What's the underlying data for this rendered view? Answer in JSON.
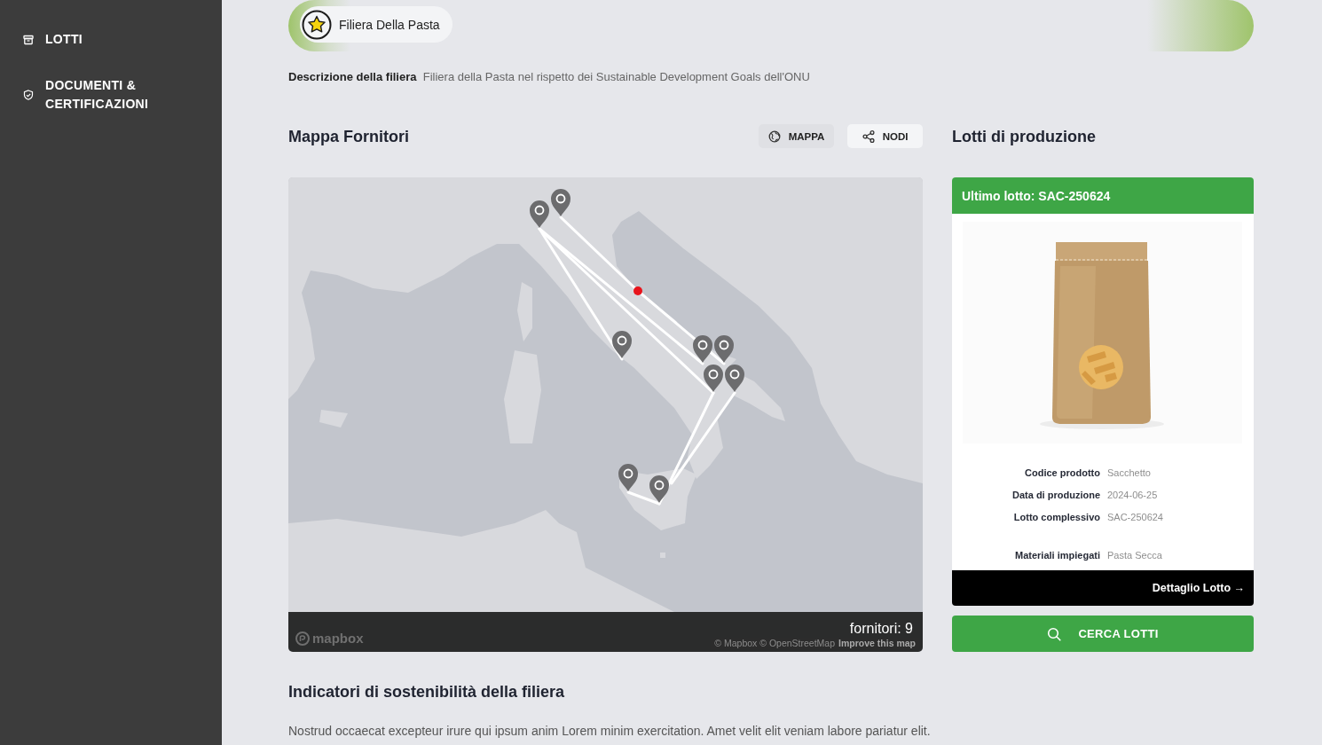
{
  "sidebar": {
    "items": [
      {
        "label": "LOTTI"
      },
      {
        "label": "DOCUMENTI & CERTIFICAZIONI"
      }
    ]
  },
  "header": {
    "title": "Filiera Della Pasta"
  },
  "description": {
    "label": "Descrizione della filiera",
    "text": "Filiera della Pasta nel rispetto dei Sustainable Development Goals dell'ONU"
  },
  "suppliers_map": {
    "title": "Mappa Fornitori",
    "view_tabs": [
      {
        "label": "MAPPA",
        "selected": true
      },
      {
        "label": "NODI",
        "selected": false
      }
    ],
    "supplier_count": "fornitori: 9",
    "logo": "mapbox",
    "attribution": "© Mapbox © OpenStreetMap",
    "improve_link": "Improve this map"
  },
  "production_lots": {
    "title": "Lotti di produzione",
    "latest_lot": {
      "header": "Ultimo lotto: SAC-250624",
      "fields": [
        {
          "label": "Codice prodotto",
          "value": "Sacchetto"
        },
        {
          "label": "Data di produzione",
          "value": "2024-06-25"
        },
        {
          "label": "Lotto complessivo",
          "value": "SAC-250624"
        },
        {
          "label": "Materiali impiegati",
          "value": "Pasta Secca"
        }
      ],
      "detail_link": "Dettaglio Lotto →"
    },
    "search_button": "CERCA LOTTI"
  },
  "sustainability": {
    "title": "Indicatori di sostenibilità della filiera",
    "text": "Nostrud occaecat excepteur irure qui ipsum anim Lorem minim exercitation. Amet velit elit veniam labore pariatur elit."
  }
}
